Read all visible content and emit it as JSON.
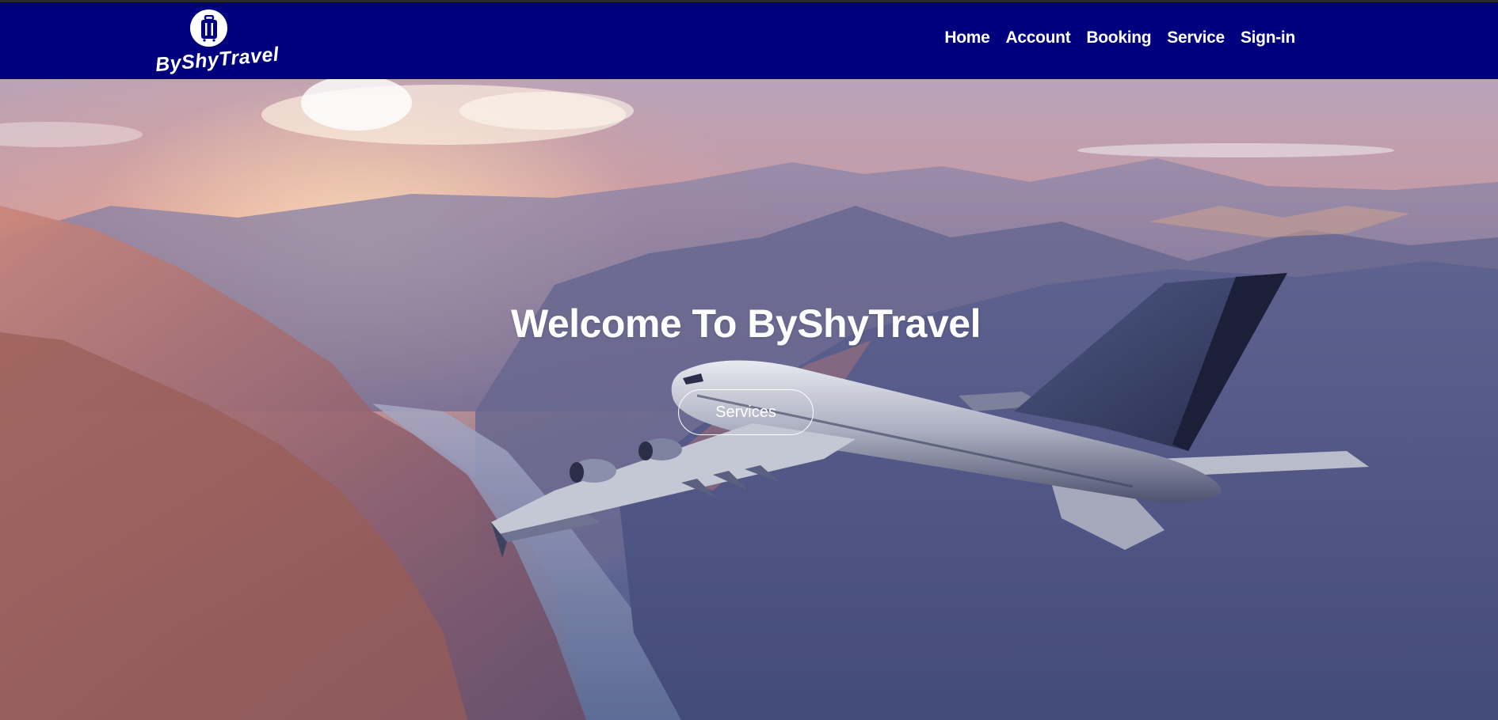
{
  "brand": {
    "name": "ByShyTravel",
    "logo_icon": "suitcase-icon",
    "nav_color": "#00007f"
  },
  "nav": {
    "items": [
      {
        "label": "Home"
      },
      {
        "label": "Account"
      },
      {
        "label": "Booking"
      },
      {
        "label": "Service"
      },
      {
        "label": "Sign-in"
      }
    ]
  },
  "hero": {
    "title": "Welcome To ByShyTravel",
    "button_label": "Services",
    "background": "airplane-over-mountains-at-sunset"
  }
}
